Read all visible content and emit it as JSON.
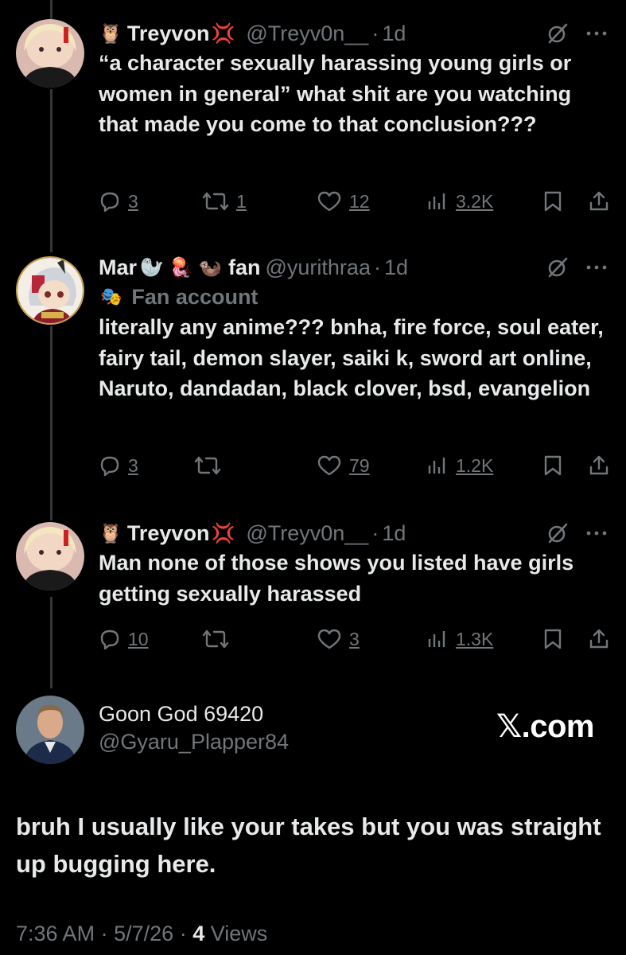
{
  "tweets": [
    {
      "emoji_prefix": "🦉",
      "name": "Treyvon",
      "emoji_suffix": "💢",
      "handle": "@Treyv0n__",
      "time": "1d",
      "text": "“a character sexually harassing young girls or women in general” what shit are you watching that made you come to that conclusion???",
      "replies": "3",
      "reposts": "1",
      "likes": "12",
      "views": "3.2K"
    },
    {
      "name": "Mar",
      "name_emojis": "🦭 🪼 🦦",
      "name_suffix": "fan",
      "handle": "@yurithraa",
      "time": "1d",
      "fan_label": "Fan account",
      "fan_icon": "🎭",
      "text": "literally any anime??? bnha, fire force, soul eater, fairy tail, demon slayer, saiki k, sword art online, Naruto, dandadan, black clover, bsd, evangelion",
      "replies": "3",
      "reposts": "",
      "likes": "79",
      "views": "1.2K"
    },
    {
      "emoji_prefix": "🦉",
      "name": "Treyvon",
      "emoji_suffix": "💢",
      "handle": "@Treyv0n__",
      "time": "1d",
      "text": "Man none of those shows you listed have girls getting sexually harassed",
      "replies": "10",
      "reposts": "",
      "likes": "3",
      "views": "1.3K"
    }
  ],
  "main": {
    "name": "Goon God 69420",
    "handle": "@Gyaru_Plapper84",
    "watermark": "𝕏.com",
    "text": "bruh I usually like your takes but you was straight up bugging here.",
    "time": "7:36 AM",
    "date": "5/7/26",
    "views_count": "4",
    "views_label": "Views"
  },
  "separator": "·",
  "colors": {
    "background": "#000000",
    "text": "#e7e9ea",
    "secondary": "#71767b",
    "thread_line": "#333639"
  },
  "icons": [
    "reply-icon",
    "repost-icon",
    "like-icon",
    "views-icon",
    "bookmark-icon",
    "share-icon",
    "grok-icon",
    "more-icon"
  ]
}
